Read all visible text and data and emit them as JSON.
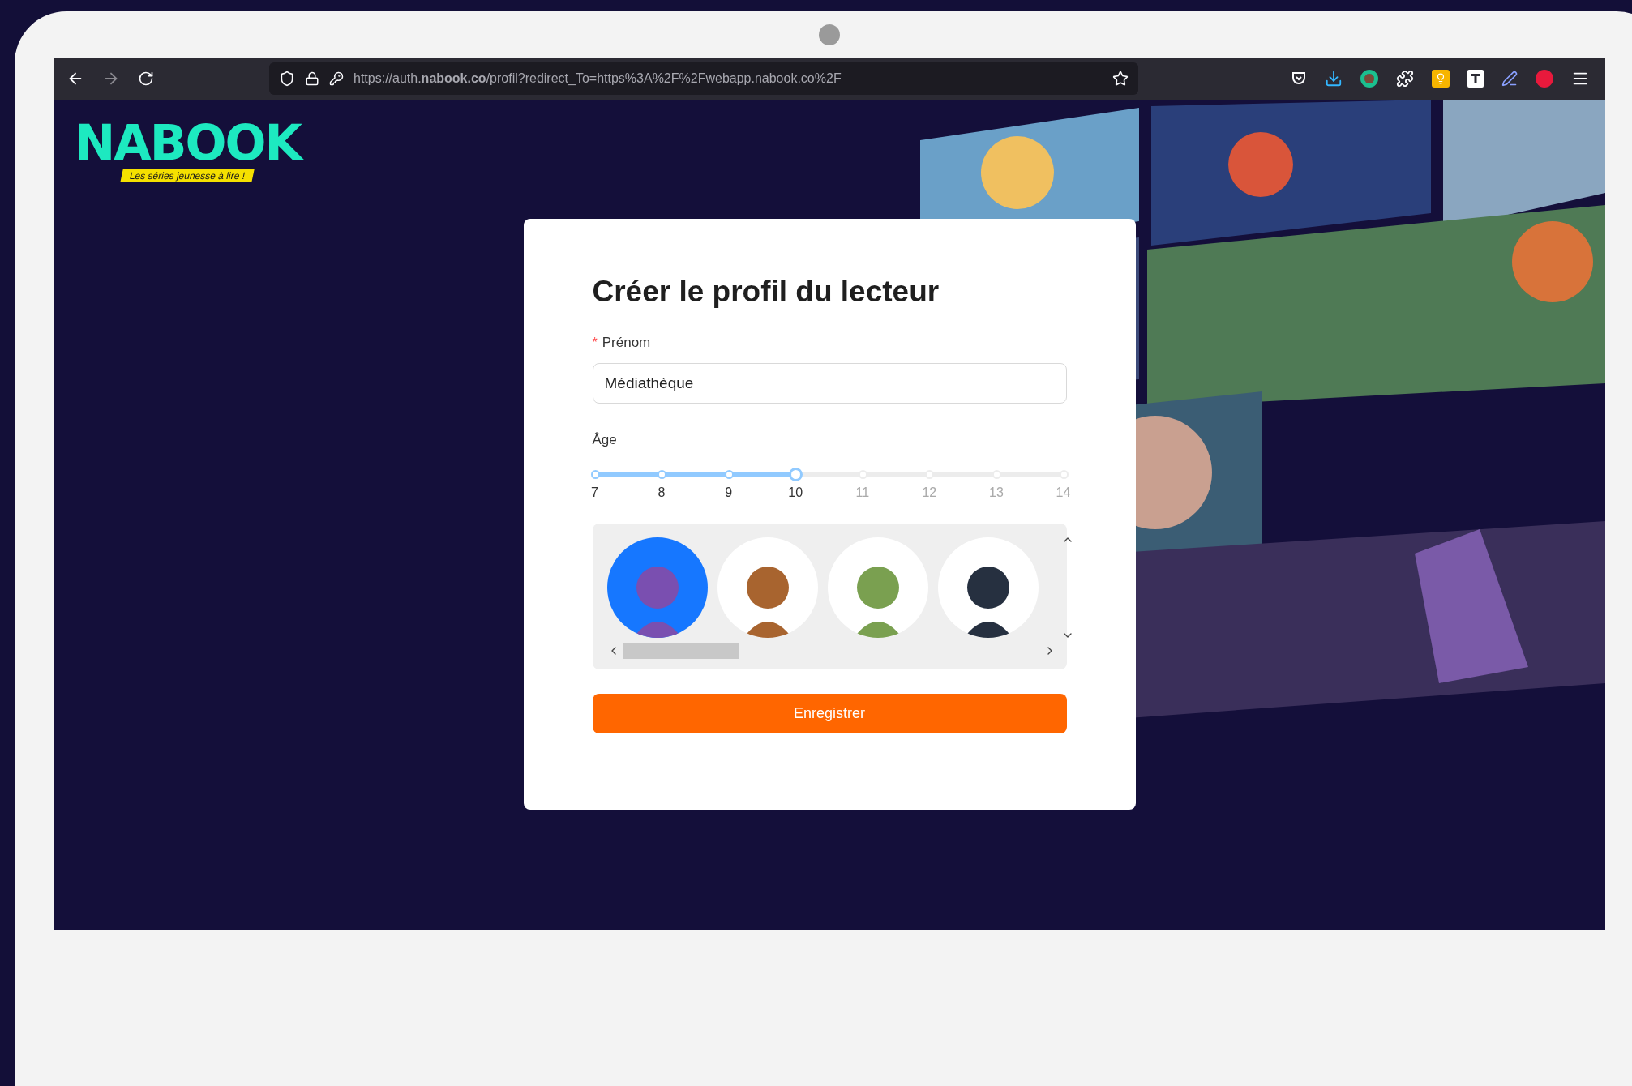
{
  "browser": {
    "url": "https://auth.**nabook.co**/profil?redirect_To=https%3A%2F%2Fwebapp.nabook.co%2F"
  },
  "logo": {
    "name": "NABOOK",
    "tagline": "Les séries jeunesse à lire !"
  },
  "form": {
    "title": "Créer le profil du lecteur",
    "name_field": {
      "required_mark": "*",
      "label": "Prénom",
      "value": "Médiathèque"
    },
    "age": {
      "label": "Âge",
      "level": 0.4286,
      "marks": [
        "7",
        "8",
        "9",
        "10",
        "11",
        "12",
        "13",
        "14"
      ]
    },
    "avatars": [
      {
        "selected": true
      },
      {
        "selected": false
      },
      {
        "selected": false
      },
      {
        "selected": false
      }
    ],
    "submit": "Enregistrer"
  }
}
